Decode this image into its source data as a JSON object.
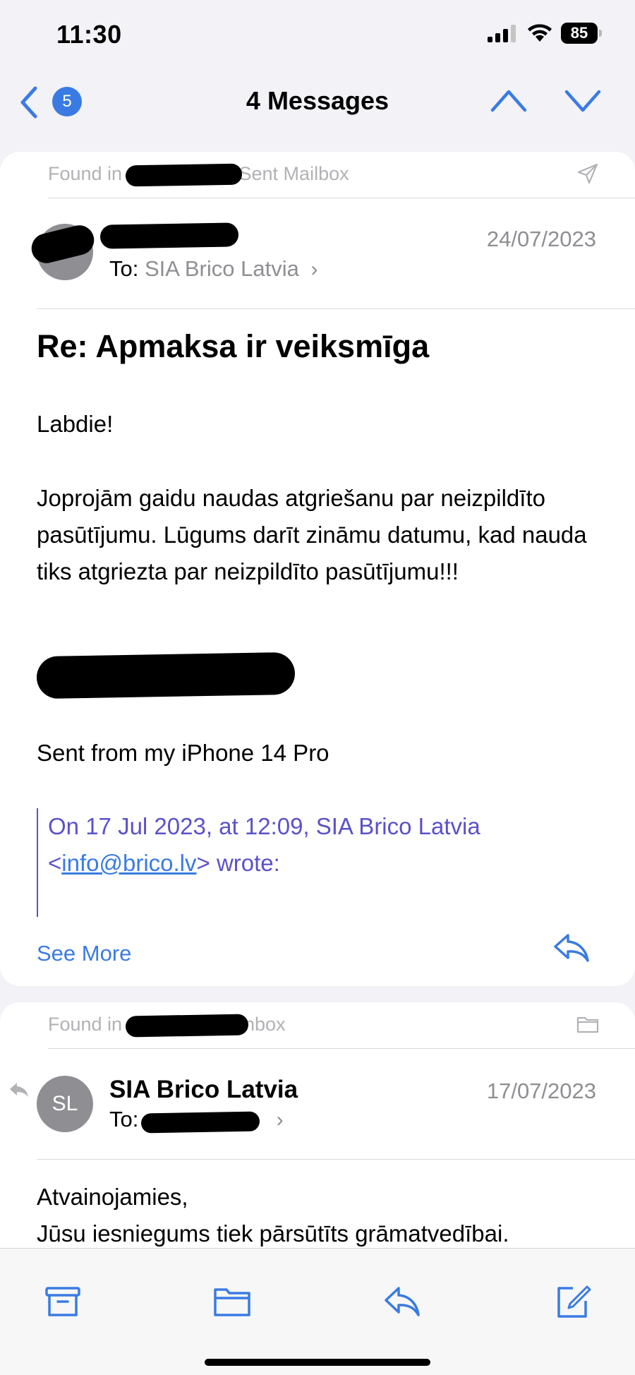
{
  "status_bar": {
    "time": "11:30",
    "battery": "85"
  },
  "nav": {
    "badge_count": "5",
    "title": "4 Messages"
  },
  "messages": [
    {
      "found_in": "Found in                    @gmail.com Sent Mailbox",
      "date": "24/07/2023",
      "to_label": "To:",
      "to_name": "SIA Brico Latvia",
      "subject": "Re: Apmaksa ir veiksmīga",
      "greeting": "Labdie!",
      "body": "Joprojām gaidu naudas atgriešanu par neizpildīto pasūtījumu. Lūgums darīt zināmu datumu, kad nauda tiks atgriezta par neizpildīto pasūtījumu!!!",
      "signature": "Sent from my iPhone 14 Pro",
      "quote_prefix": "On 17 Jul 2023, at 12:09, SIA Brico Latvia",
      "quote_lt": "<",
      "quote_email": "info@brico.lv",
      "quote_suffix": "> wrote:",
      "see_more": "See More"
    },
    {
      "found_in": "Found in                    @gmail.com Inbox",
      "avatar_initials": "SL",
      "sender": "SIA Brico Latvia",
      "date": "17/07/2023",
      "to_label": "To:",
      "body_line1": "Atvainojamies,",
      "body_line2": "Jūsu iesniegums tiek pārsūtīts grāmatvedībai."
    }
  ],
  "icons": {
    "back": "chevron-left-icon",
    "up": "chevron-up-icon",
    "down": "chevron-down-icon",
    "sent": "paper-plane-icon",
    "folder": "folder-icon",
    "reply": "reply-icon",
    "archive": "archive-icon",
    "move": "folder-icon",
    "compose": "compose-icon"
  },
  "colors": {
    "accent": "#3a7be3",
    "quote": "#5b51c9",
    "meta_gray": "#8e8e93"
  }
}
